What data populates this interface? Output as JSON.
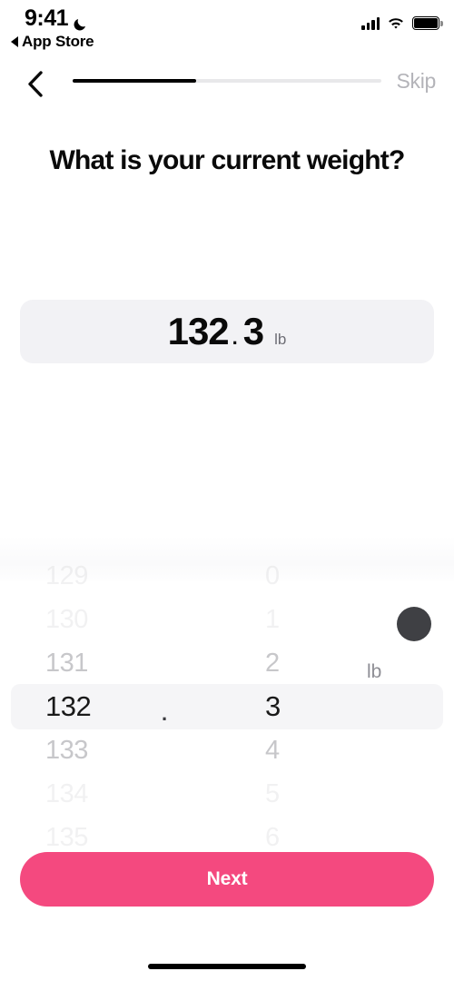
{
  "status_bar": {
    "time": "9:41",
    "moon_icon": "moon-icon",
    "back_app_label": "App Store",
    "signal_icon": "cellular-signal-icon",
    "wifi_icon": "wifi-icon",
    "battery_icon": "battery-full-icon"
  },
  "nav": {
    "back_icon": "chevron-left-icon",
    "skip_label": "Skip",
    "progress_percent": 40
  },
  "page": {
    "title": "What is your current weight?"
  },
  "weight_display": {
    "integer": "132",
    "separator": ".",
    "decimal": "3",
    "unit": "lb"
  },
  "picker": {
    "unit_label": "lb",
    "separator": ".",
    "touch_indicator": "touch-point-indicator",
    "integer_column": {
      "values": [
        "129",
        "130",
        "131",
        "132",
        "133",
        "134",
        "135"
      ],
      "selected": "132",
      "selected_index": 3
    },
    "decimal_column": {
      "values": [
        "0",
        "1",
        "2",
        "3",
        "4",
        "5",
        "6"
      ],
      "selected": "3",
      "selected_index": 3
    }
  },
  "footer": {
    "next_label": "Next",
    "next_color": "#f4497f",
    "home_indicator": "home-indicator"
  }
}
